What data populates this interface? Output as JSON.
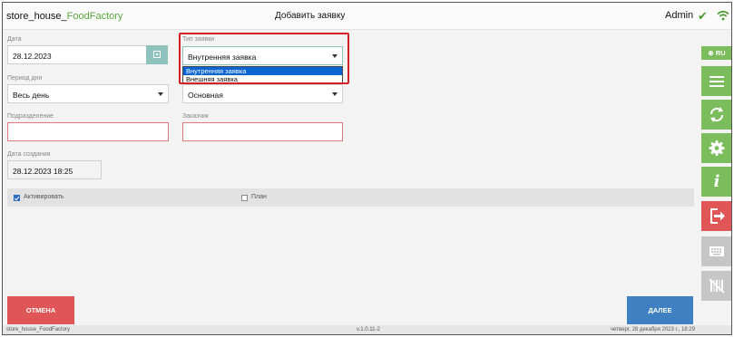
{
  "header": {
    "app_name": "store_house_",
    "app_name_accent": "FoodFactory",
    "page_title": "Добавить заявку",
    "user": "Admin",
    "status_icon": "check-icon",
    "network_icon": "wifi-icon"
  },
  "form": {
    "date": {
      "label": "Дата",
      "value": "28.12.2023"
    },
    "request_type": {
      "label": "Тип заявки",
      "value": "Внутренняя заявка",
      "options": [
        "Внутренняя заявка",
        "Внешняя заявка"
      ]
    },
    "day_period": {
      "label": "Период дня",
      "value": "Весь день"
    },
    "second_select": {
      "value": "Основная"
    },
    "department": {
      "label": "Подразделение",
      "value": ""
    },
    "customer": {
      "label": "Заказчик",
      "value": ""
    },
    "created_date": {
      "label": "Дата создания",
      "value": "28.12.2023 18:25"
    },
    "activate": {
      "label": "Активировать",
      "checked": true
    },
    "plan": {
      "label": "План",
      "checked": false
    }
  },
  "buttons": {
    "cancel": "ОТМЕНА",
    "next": "ДАЛЕЕ"
  },
  "sidebar": {
    "lang": "RU",
    "items": [
      "menu-icon",
      "refresh-icon",
      "gear-icon",
      "info-icon",
      "logout-icon",
      "keyboard-icon",
      "barcode-off-icon"
    ]
  },
  "footer": {
    "app": "store_house_FoodFactory",
    "version": "v.1.0.11-2",
    "datetime": "четверг, 28 декабря 2023 г., 18:29"
  },
  "colors": {
    "accent_green": "#7bbd5c",
    "danger_red": "#e05555",
    "primary_blue": "#3f80c2",
    "highlight_red": "#d61f26"
  }
}
